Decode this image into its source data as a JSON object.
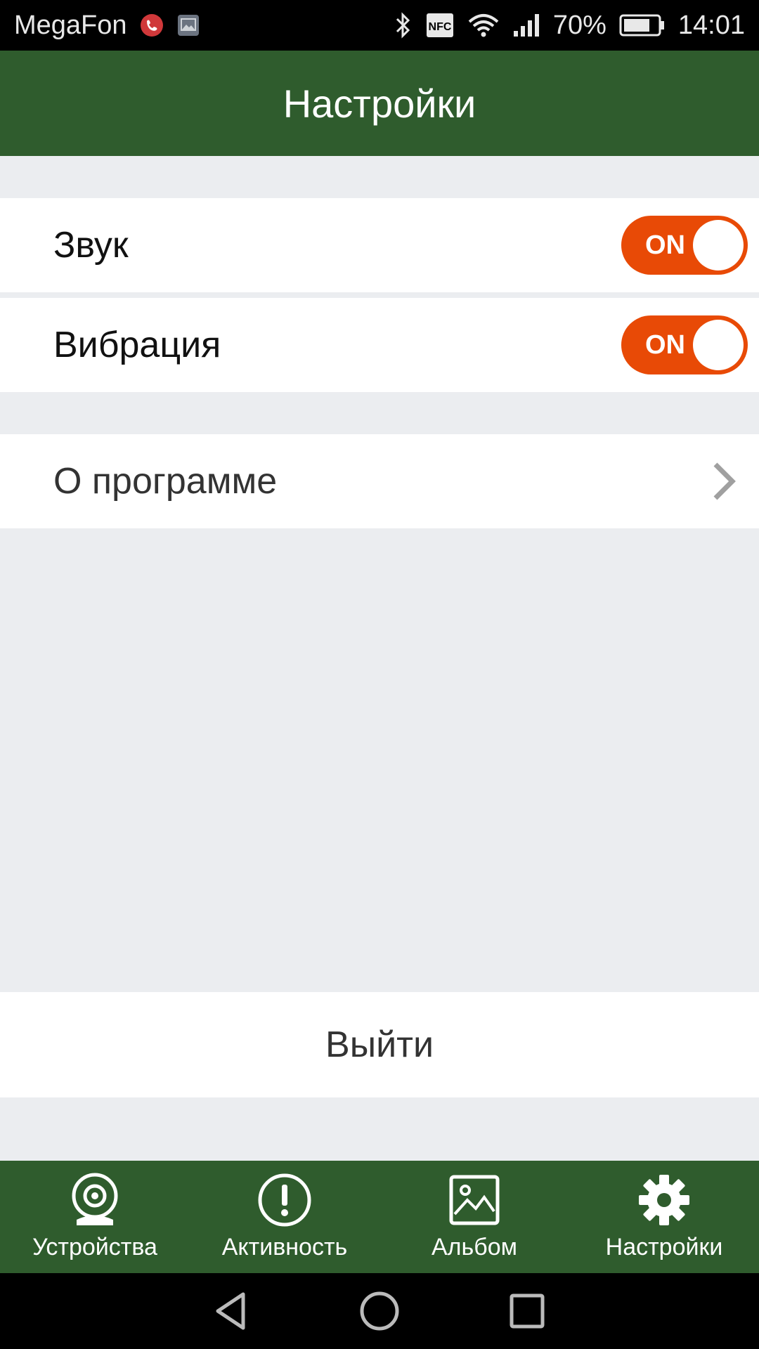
{
  "status_bar": {
    "carrier": "MegaFon",
    "battery_percent": "70%",
    "time": "14:01",
    "nfc": "NFC",
    "icons": [
      "phone-call-icon",
      "gallery-icon",
      "bluetooth-icon",
      "nfc-icon",
      "wifi-icon",
      "signal-icon",
      "battery-icon"
    ]
  },
  "header": {
    "title": "Настройки"
  },
  "settings": {
    "sound": {
      "label": "Звук",
      "toggle": "ON"
    },
    "vibration": {
      "label": "Вибрация",
      "toggle": "ON"
    },
    "about": {
      "label": "О программе"
    }
  },
  "logout": {
    "label": "Выйти"
  },
  "bottom_nav": {
    "items": [
      {
        "label": "Устройства",
        "icon": "camera-device-icon"
      },
      {
        "label": "Активность",
        "icon": "alert-icon"
      },
      {
        "label": "Альбом",
        "icon": "album-icon"
      },
      {
        "label": "Настройки",
        "icon": "gear-icon"
      }
    ]
  },
  "colors": {
    "header_bg": "#2f5c2d",
    "toggle_on": "#e84a06",
    "page_bg": "#ebedf0"
  }
}
